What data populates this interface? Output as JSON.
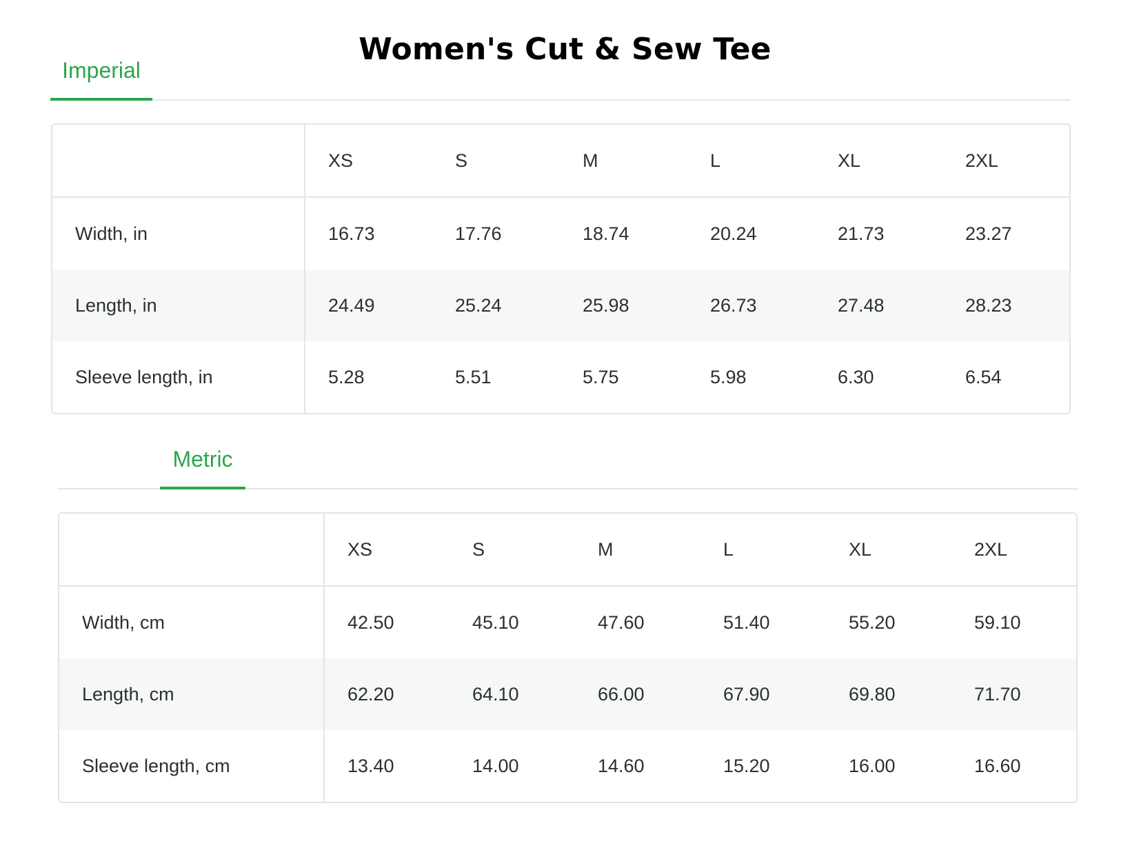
{
  "title": "Women's Cut & Sew Tee",
  "accent_color": "#2aa64a",
  "imperial": {
    "tab_label": "Imperial",
    "headers": [
      "XS",
      "S",
      "M",
      "L",
      "XL",
      "2XL"
    ],
    "rows": [
      {
        "label": "Width, in",
        "values": [
          "16.73",
          "17.76",
          "18.74",
          "20.24",
          "21.73",
          "23.27"
        ]
      },
      {
        "label": "Length, in",
        "values": [
          "24.49",
          "25.24",
          "25.98",
          "26.73",
          "27.48",
          "28.23"
        ]
      },
      {
        "label": "Sleeve length, in",
        "values": [
          "5.28",
          "5.51",
          "5.75",
          "5.98",
          "6.30",
          "6.54"
        ]
      }
    ]
  },
  "metric": {
    "tab_label": "Metric",
    "headers": [
      "XS",
      "S",
      "M",
      "L",
      "XL",
      "2XL"
    ],
    "rows": [
      {
        "label": "Width, cm",
        "values": [
          "42.50",
          "45.10",
          "47.60",
          "51.40",
          "55.20",
          "59.10"
        ]
      },
      {
        "label": "Length, cm",
        "values": [
          "62.20",
          "64.10",
          "66.00",
          "67.90",
          "69.80",
          "71.70"
        ]
      },
      {
        "label": "Sleeve length, cm",
        "values": [
          "13.40",
          "14.00",
          "14.60",
          "15.20",
          "16.00",
          "16.60"
        ]
      }
    ]
  }
}
